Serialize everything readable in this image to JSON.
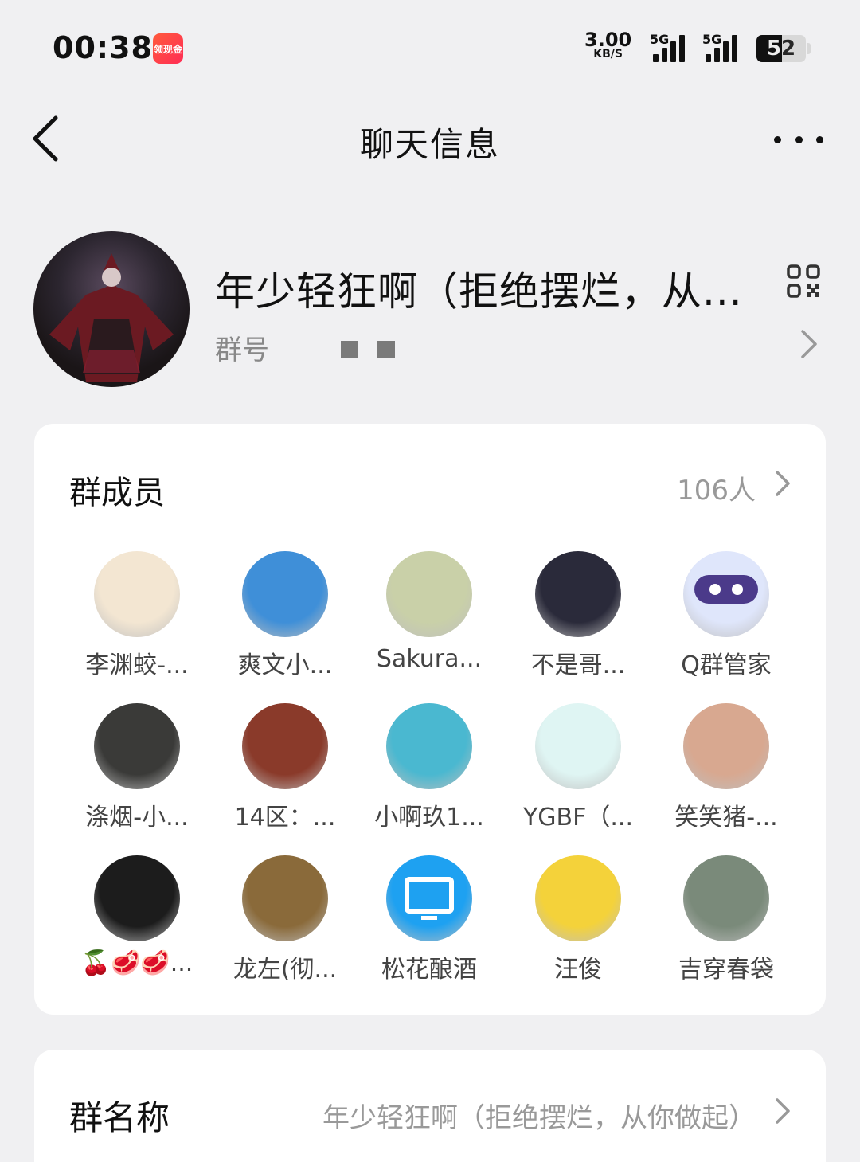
{
  "status_bar": {
    "time": "00:38",
    "app_badge": "领现金",
    "speed_value": "3.00",
    "speed_unit": "KB/S",
    "network_1": "5G",
    "network_2": "5G",
    "battery": "52"
  },
  "nav": {
    "title": "聊天信息"
  },
  "group": {
    "name": "年少轻狂啊（拒绝摆烂，从...",
    "id_label": "群号"
  },
  "members_section": {
    "title": "群成员",
    "count": "106人",
    "members": [
      {
        "name": "李渊蛟-...",
        "color": "#f3e6d2"
      },
      {
        "name": "爽文小...",
        "color": "#3f8fd8"
      },
      {
        "name": "Sakura...",
        "color": "#c9d0a8"
      },
      {
        "name": "不是哥...",
        "color": "#2a2a3a"
      },
      {
        "name": "Q群管家",
        "color": "#dfe6fb"
      },
      {
        "name": "涤烟-小...",
        "color": "#3a3a38"
      },
      {
        "name": "14区：...",
        "color": "#8a3a2a"
      },
      {
        "name": "小啊玖1...",
        "color": "#4ab8d0"
      },
      {
        "name": "YGBF（...",
        "color": "#dff5f3"
      },
      {
        "name": "笑笑猪-...",
        "color": "#d8a890"
      },
      {
        "name": "🍒🥩🥩...",
        "color": "#1c1c1c"
      },
      {
        "name": "龙左(彻...",
        "color": "#8a6a3a"
      },
      {
        "name": "松花酿酒",
        "color": "#1ea1f1"
      },
      {
        "name": "汪俊",
        "color": "#f4d23a"
      },
      {
        "name": "吉穿春袋",
        "color": "#7a8a7a"
      }
    ]
  },
  "group_name_row": {
    "label": "群名称",
    "value": "年少轻狂啊（拒绝摆烂，从你做起）"
  }
}
